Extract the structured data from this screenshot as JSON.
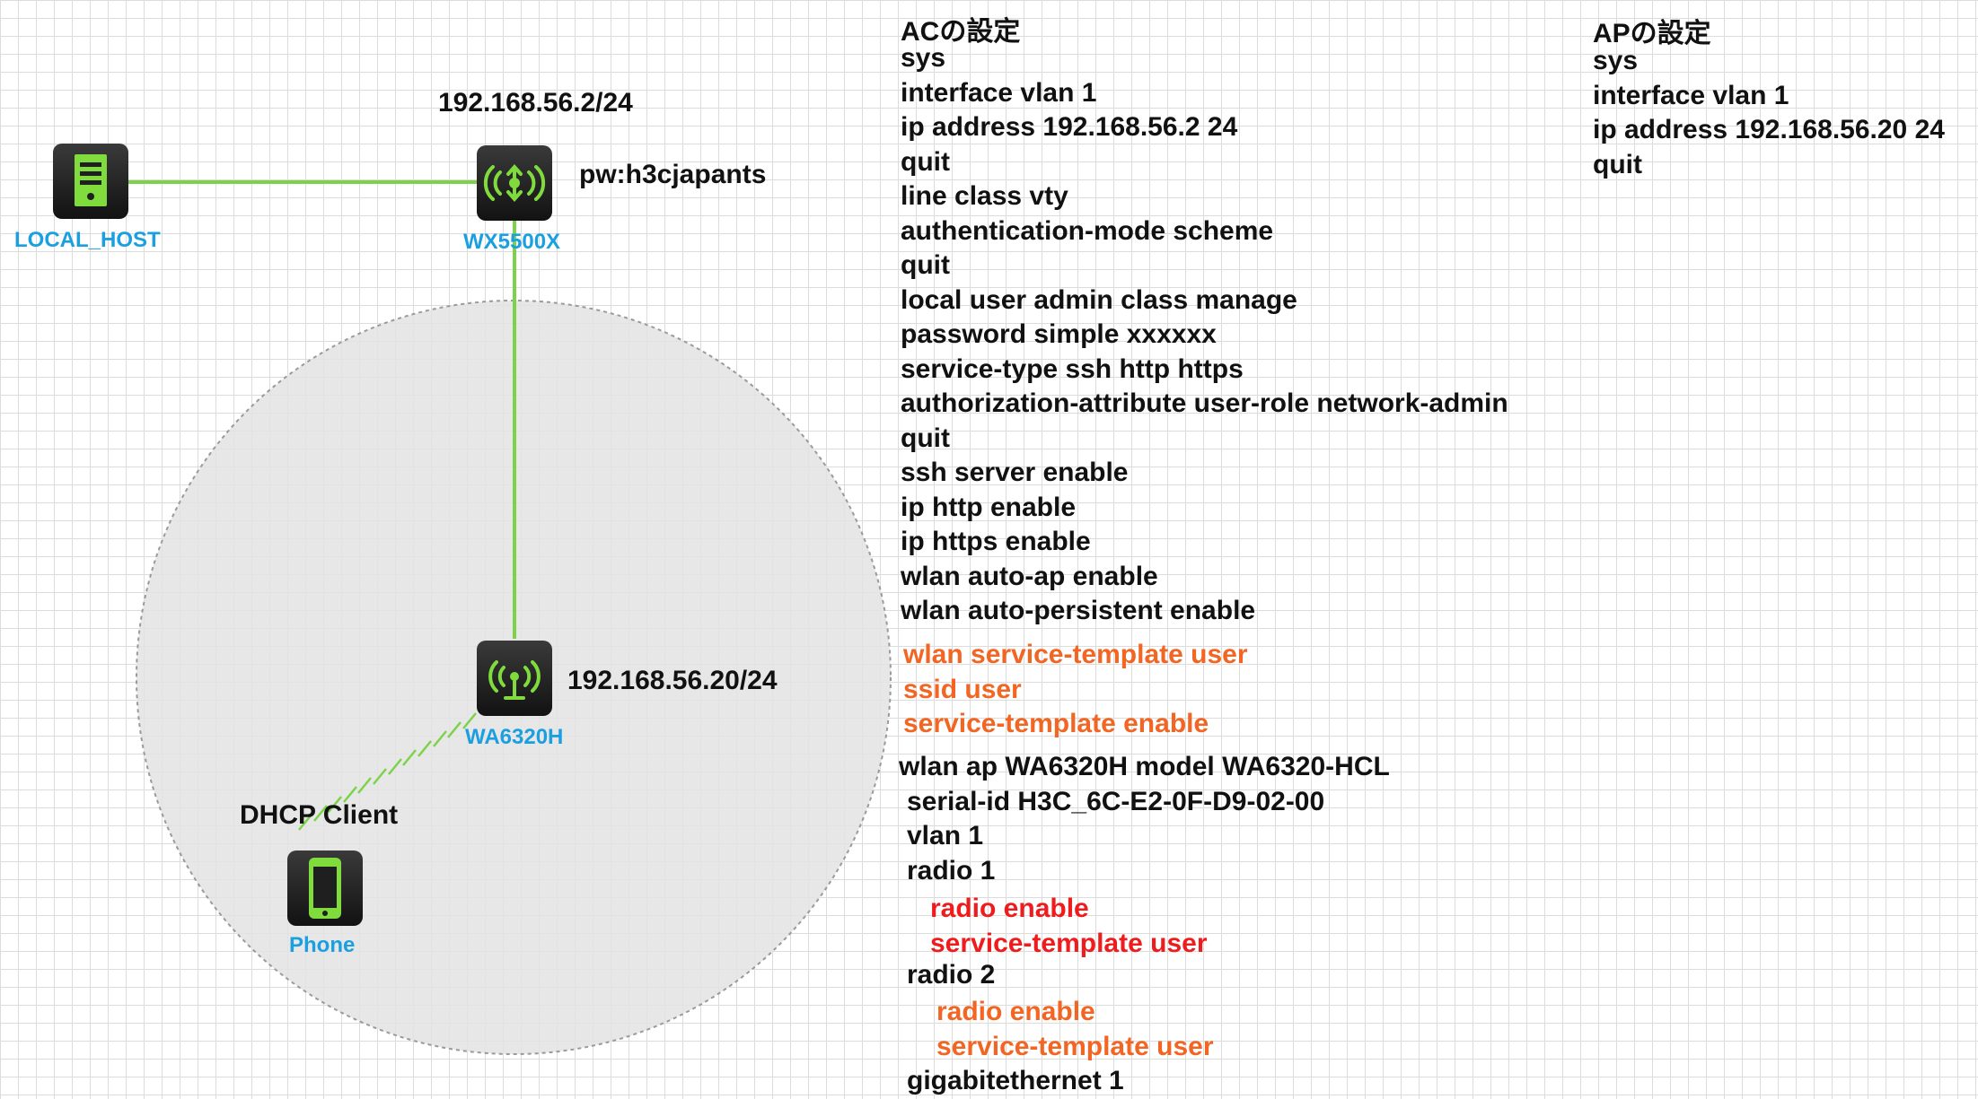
{
  "devices": {
    "local_host": "LOCAL_HOST",
    "wx": "WX5500X",
    "wa": "WA6320H",
    "phone": "Phone"
  },
  "labels": {
    "wx_ip": "192.168.56.2/24",
    "wx_pw": "pw:h3cjapants",
    "wa_ip": "192.168.56.20/24",
    "dhcp": "DHCP Client"
  },
  "ac_config": {
    "title": "ACの設定",
    "block1": [
      "sys",
      "interface vlan 1",
      "ip address 192.168.56.2 24",
      "quit",
      "line class vty",
      "authentication-mode scheme",
      "quit",
      "local user admin class manage",
      "password simple xxxxxx",
      "service-type ssh http https",
      "authorization-attribute user-role network-admin",
      "quit",
      "ssh server enable",
      "ip http enable",
      "ip https enable",
      "wlan auto-ap enable",
      "wlan auto-persistent enable"
    ],
    "block2": [
      "wlan service-template user",
      "ssid user",
      "service-template enable"
    ],
    "block3": [
      "wlan ap WA6320H model WA6320-HCL",
      "serial-id H3C_6C-E2-0F-D9-02-00",
      "vlan 1",
      "radio 1"
    ],
    "block4": [
      "radio enable",
      "service-template user"
    ],
    "block5": [
      "radio 2"
    ],
    "block6": [
      "radio enable",
      "service-template user"
    ],
    "block7": [
      "gigabitethernet 1"
    ]
  },
  "ap_config": {
    "title": "APの設定",
    "lines": [
      "sys",
      "interface vlan 1",
      "ip address 192.168.56.20 24",
      "quit"
    ]
  },
  "colors": {
    "link": "#7cd34a",
    "device_body": "#1f1f1f",
    "device_icon": "#7fdc3c",
    "device_label": "#1a9fe0",
    "orange_text": "#f26522",
    "red_text": "#ee1c1c"
  }
}
